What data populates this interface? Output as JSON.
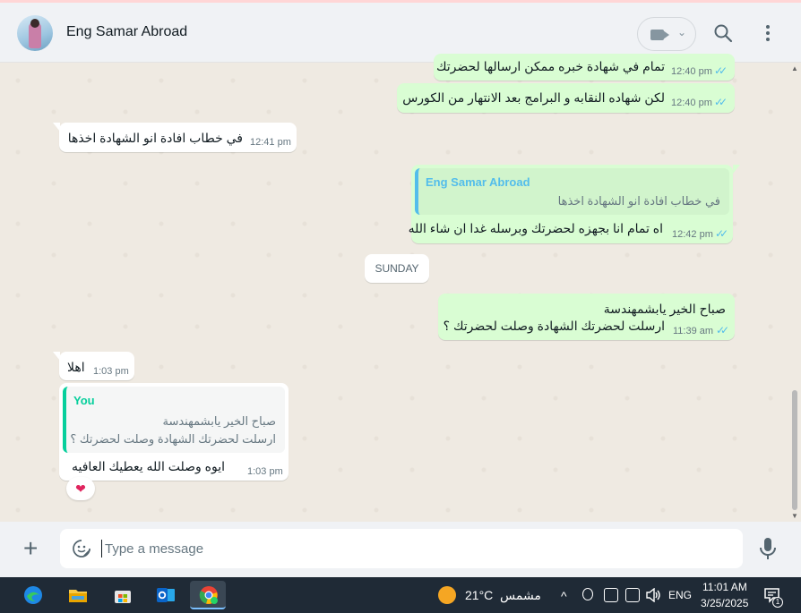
{
  "header": {
    "contact_name": "Eng Samar Abroad",
    "video_chevron": "⌄"
  },
  "messages": [
    {
      "text": "تمام في شهادة خبره ممكن ارسالها لحضرتك",
      "time": "12:40 pm"
    },
    {
      "text": "لكن شهاده النقابه و البرامج بعد الانتهار من الكورس",
      "time": "12:40 pm"
    },
    {
      "text": "في خطاب افادة انو الشهادة اخذها",
      "time": "12:41 pm"
    },
    {
      "quote_name": "Eng Samar Abroad",
      "quote_text": "في خطاب افادة انو الشهادة اخذها",
      "text": "اه تمام انا بجهزه لحضرتك وبرسله غدا ان شاء الله",
      "time": "12:42 pm"
    },
    {
      "line1": "صباح الخير يابشمهندسة",
      "line2": "ارسلت لحضرتك الشهادة وصلت لحضرتك ؟",
      "time": "11:39 am"
    },
    {
      "text": "اهلا",
      "time": "1:03 pm"
    },
    {
      "quote_name": "You",
      "quote_line1": "صباح الخير يابشمهندسة",
      "quote_line2": "ارسلت لحضرتك الشهادة وصلت لحضرتك ؟",
      "text": "ايوه وصلت الله يعطيك العافيه",
      "time": "1:03 pm",
      "reaction": "❤"
    }
  ],
  "day_divider": "SUNDAY",
  "composer": {
    "plus": "+",
    "placeholder": "Type a message"
  },
  "taskbar": {
    "weather_temp": "21°C",
    "weather_label": "مشمس",
    "language": "ENG",
    "time": "11:01 AM",
    "date": "3/25/2025",
    "chevron": "^",
    "notif_count": "1",
    "colors": {
      "edge": "#1e88e5",
      "chrome_red": "#ea4335",
      "chrome_yellow": "#fbbc05",
      "chrome_green": "#34a853",
      "outlook": "#0a64c8"
    }
  },
  "colors": {
    "outgoing": "#d9fdd3",
    "incoming": "#ffffff",
    "tick_blue": "#53bdeb",
    "quote_teal": "#06cf9c"
  }
}
